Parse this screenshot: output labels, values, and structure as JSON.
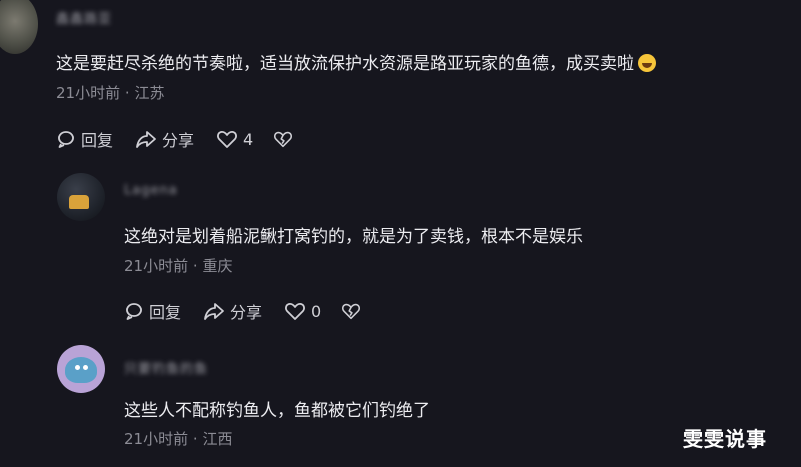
{
  "comments": [
    {
      "username": "鑫鑫路亚",
      "text": "这是要赶尽杀绝的节奏啦，适当放流保护水资源是路亚玩家的鱼德，成买卖啦",
      "emoji": "rofl-emoji",
      "time": "21小时前",
      "location": "江苏",
      "reply_label": "回复",
      "share_label": "分享",
      "likes": "4"
    },
    {
      "username": "Lagena",
      "text": "这绝对是划着船泥鳅打窝钓的，就是为了卖钱，根本不是娱乐",
      "time": "21小时前",
      "location": "重庆",
      "reply_label": "回复",
      "share_label": "分享",
      "likes": "0"
    },
    {
      "username": "只要钓鱼的鱼",
      "text": "这些人不配称钓鱼人，鱼都被它们钓绝了",
      "time": "21小时前",
      "location": "江西"
    }
  ],
  "meta_separator": "·",
  "watermark": "雯雯说事",
  "colors": {
    "background": "#16161e",
    "text": "#ececf0",
    "meta": "#8c8c95"
  }
}
